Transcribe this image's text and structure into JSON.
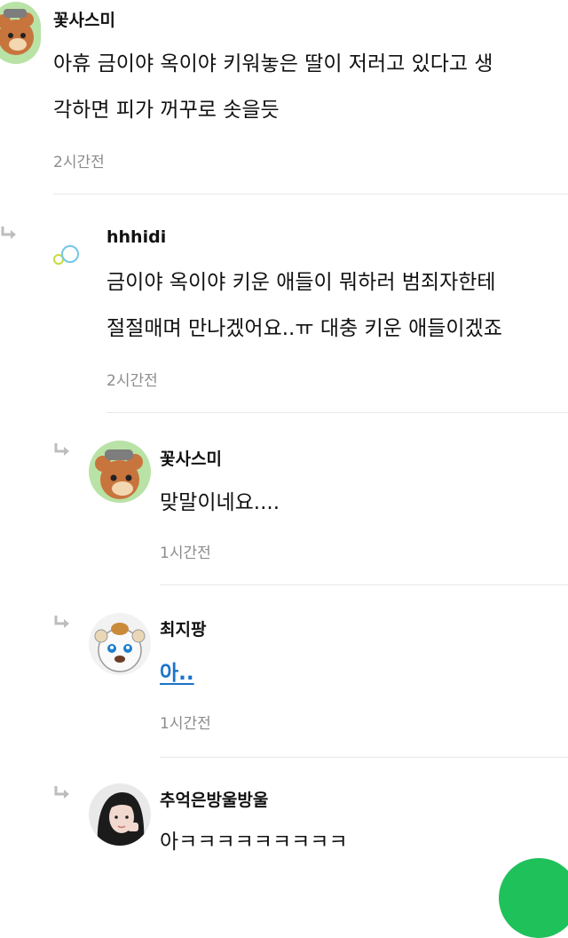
{
  "comments": [
    {
      "nickname": "꽃사스미",
      "line1": "아휴 금이야 옥이야 키워놓은 딸이 저러고 있다고 생",
      "line2": "각하면 피가 꺼꾸로 솟을듯",
      "time": "2시간전"
    },
    {
      "nickname": "hhhidi",
      "line1": "금이야 옥이야 키운 애들이 뭐하러 범죄자한테",
      "line2": "절절매며 만나겠어요..ㅠ 대충 키운 애들이겠죠",
      "time": "2시간전"
    },
    {
      "nickname": "꽃사스미",
      "line1": "맞말이네요....",
      "time": "1시간전"
    },
    {
      "nickname": "최지팡",
      "line1": "아..",
      "time": "1시간전"
    },
    {
      "nickname": "추억은방울방울",
      "line1": "아ㅋㅋㅋㅋㅋㅋㅋㅋㅋ"
    }
  ],
  "colors": {
    "text": "#111111",
    "time": "#8c8c8c",
    "link": "#1a73c9",
    "divider": "#e8e8e8",
    "accent": "#1fc15a"
  },
  "icons": [
    "reply-arrow-icon",
    "avatar-bear",
    "avatar-bubbles",
    "avatar-hamster",
    "avatar-girl"
  ]
}
